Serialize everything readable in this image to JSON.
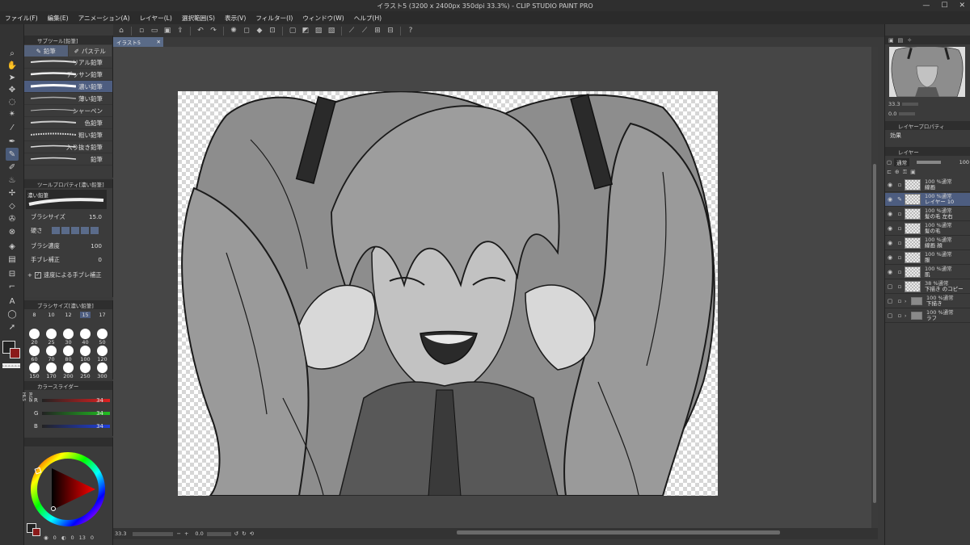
{
  "window": {
    "title": "イラスト5 (3200 x 2400px 350dpi 33.3%) - CLIP STUDIO PAINT PRO",
    "controls": [
      "—",
      "☐",
      "✕"
    ]
  },
  "menu": [
    "ファイル(F)",
    "編集(E)",
    "アニメーション(A)",
    "レイヤー(L)",
    "選択範囲(S)",
    "表示(V)",
    "フィルター(I)",
    "ウィンドウ(W)",
    "ヘルプ(H)"
  ],
  "subtool_panel": {
    "title": "サブツール[鉛筆]",
    "tabs": [
      "鉛筆",
      "パステル"
    ],
    "brushes": [
      "リアル鉛筆",
      "デッサン鉛筆",
      "濃い鉛筆",
      "薄い鉛筆",
      "シャーペン",
      "色鉛筆",
      "粗い鉛筆",
      "入り抜き鉛筆",
      "鉛筆"
    ],
    "selected_brush": "濃い鉛筆"
  },
  "tool_property": {
    "title": "ツールプロパティ[濃い鉛筆]",
    "preset_name": "濃い鉛筆",
    "brush_size_label": "ブラシサイズ",
    "brush_size_value": "15.0",
    "hardness_label": "硬さ",
    "density_label": "ブラシ濃度",
    "density_value": "100",
    "stabilization_label": "手ブレ補正",
    "stabilization_value": "0",
    "speed_stabilization_label": "速度による手ブレ補正"
  },
  "brush_size_panel": {
    "title": "ブラシサイズ[濃い鉛筆]",
    "sizes": [
      "8",
      "10",
      "12",
      "15",
      "17",
      "20",
      "25",
      "30",
      "40",
      "50",
      "60",
      "70",
      "80",
      "100",
      "120",
      "150",
      "170",
      "200",
      "250",
      "300"
    ],
    "selected": "15"
  },
  "color_slider": {
    "title": "カラースライダー",
    "mode_tabs": [
      "RGB",
      "HLS",
      "CMY"
    ],
    "channels": [
      {
        "label": "R",
        "value": "34"
      },
      {
        "label": "G",
        "value": "34"
      },
      {
        "label": "B",
        "value": "34"
      }
    ]
  },
  "color_wheel": {
    "h_value": "0",
    "s_value": "0",
    "v_value": "13",
    "other_value": "0",
    "main_color": "#222222",
    "sub_color": "#8b1a1a"
  },
  "canvas": {
    "tab_label": "イラスト5",
    "zoom": "33.3",
    "angle": "0.0"
  },
  "layer_property": {
    "title": "レイヤープロパティ",
    "effect_label": "効果"
  },
  "layer_panel": {
    "title": "レイヤー",
    "blend_mode": "通常",
    "opacity": "100",
    "layers": [
      {
        "opacity": "100 %",
        "mode": "通常",
        "name": "線画",
        "visible": true,
        "type": "raster"
      },
      {
        "opacity": "100 %",
        "mode": "通常",
        "name": "レイヤー 10",
        "visible": true,
        "type": "raster",
        "selected": true
      },
      {
        "opacity": "100 %",
        "mode": "通常",
        "name": "髪の毛 左右",
        "visible": true,
        "type": "raster"
      },
      {
        "opacity": "100 %",
        "mode": "通常",
        "name": "髪の毛",
        "visible": true,
        "type": "raster"
      },
      {
        "opacity": "100 %",
        "mode": "通常",
        "name": "線画 顔",
        "visible": true,
        "type": "raster"
      },
      {
        "opacity": "100 %",
        "mode": "通常",
        "name": "服",
        "visible": true,
        "type": "raster"
      },
      {
        "opacity": "100 %",
        "mode": "通常",
        "name": "肌",
        "visible": true,
        "type": "raster"
      },
      {
        "opacity": "38 %",
        "mode": "通常",
        "name": "下描き のコピー",
        "visible": false,
        "type": "raster"
      },
      {
        "opacity": "100 %",
        "mode": "通常",
        "name": "下描き",
        "visible": false,
        "type": "folder"
      },
      {
        "opacity": "100 %",
        "mode": "通常",
        "name": "ラフ",
        "visible": false,
        "type": "folder"
      }
    ]
  },
  "navigator": {
    "zoom": "33.3",
    "angle": "0.0"
  }
}
